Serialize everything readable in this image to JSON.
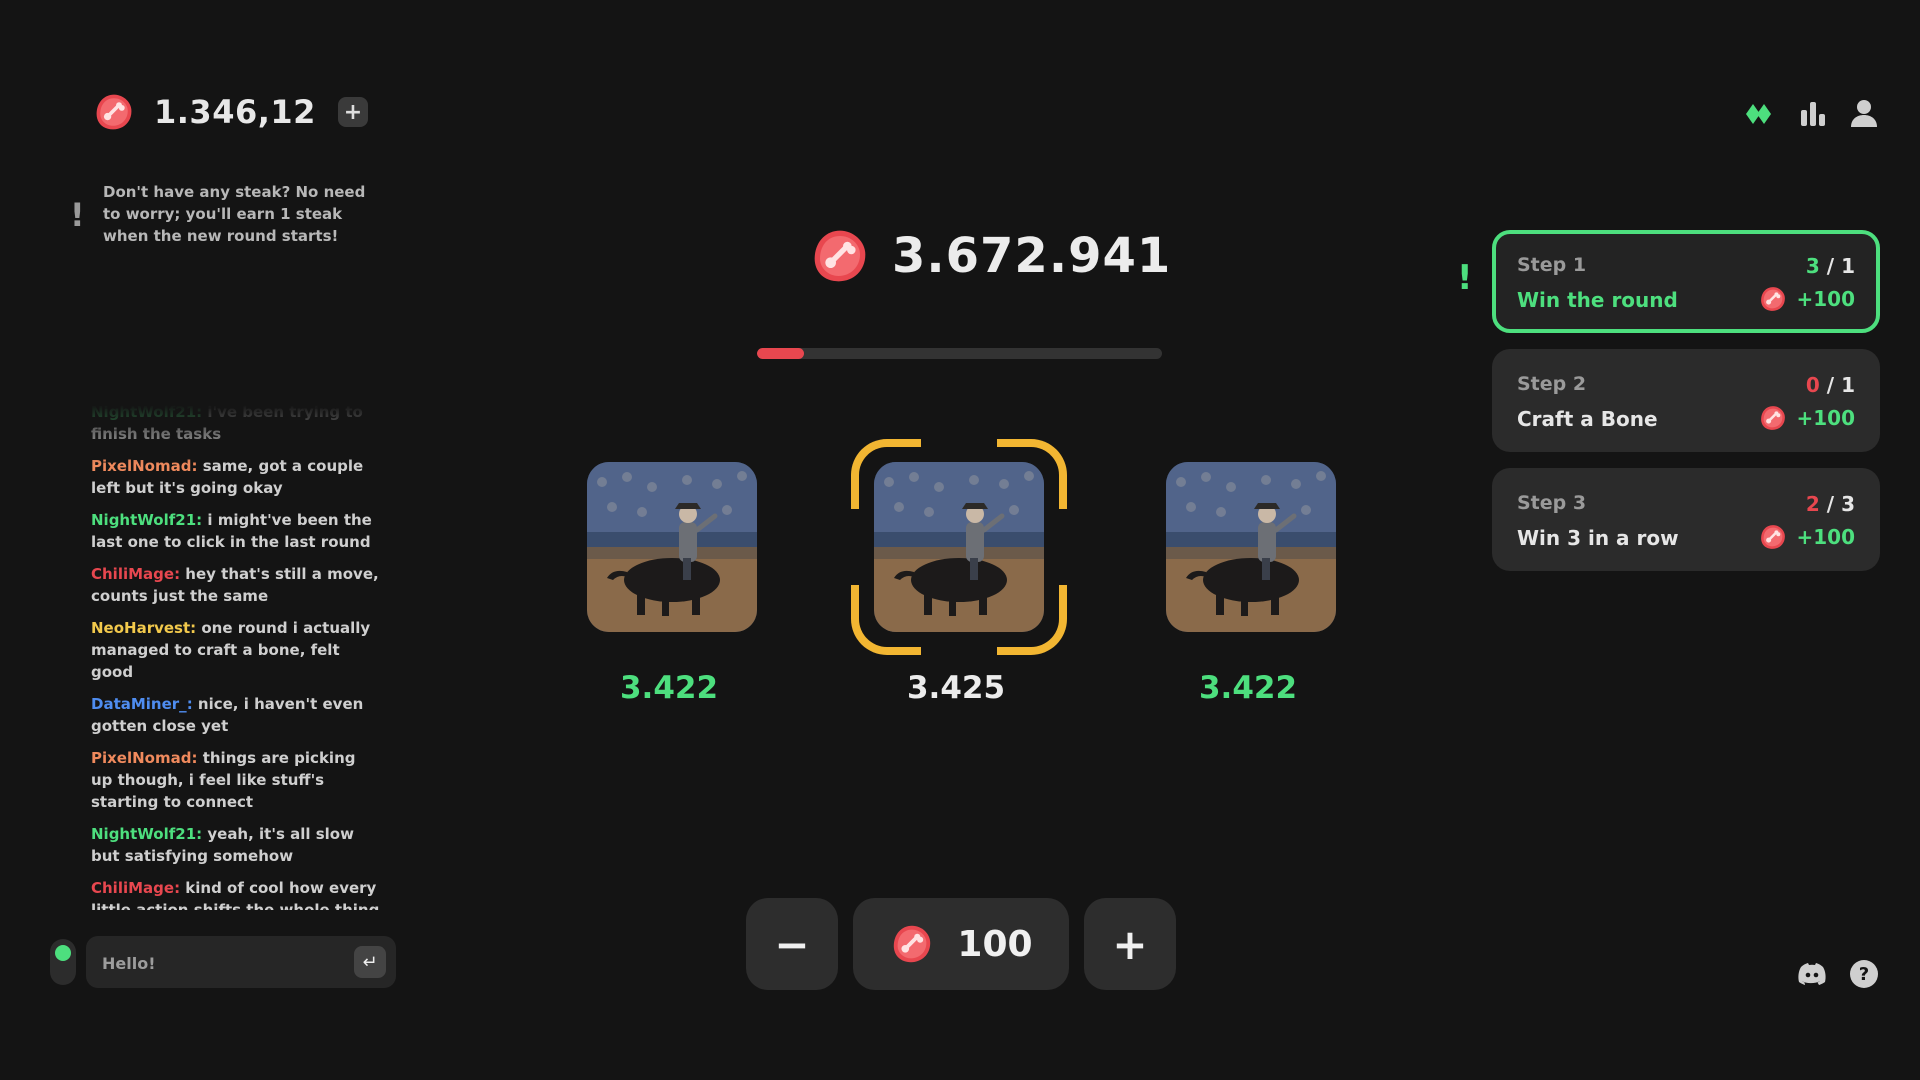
{
  "wallet": {
    "balance": "1.346,12",
    "add_label": "+",
    "icon": "steak-icon"
  },
  "info": {
    "text": "Don't have any steak? No need to worry; you'll earn 1 steak when the new round starts!",
    "mark": "!"
  },
  "chat": {
    "messages": [
      {
        "user": "NightWolf21",
        "sep": ":",
        "text": " i've been trying to finish the tasks",
        "color": "#4ddf7e"
      },
      {
        "user": "PixelNomad",
        "sep": ":",
        "text": " same, got a couple left but it's going okay",
        "color": "#f08a5d"
      },
      {
        "user": "NightWolf21",
        "sep": ":",
        "text": " i might've been the last one to click in the last round",
        "color": "#4ddf7e"
      },
      {
        "user": "ChiliMage",
        "sep": ":",
        "text": " hey that's still a move, counts just the same",
        "color": "#e8474f"
      },
      {
        "user": "NeoHarvest",
        "sep": ":",
        "text": " one round i actually managed to craft a bone, felt good",
        "color": "#f2c94c"
      },
      {
        "user": "DataMiner_",
        "sep": ":",
        "text": " nice, i haven't even gotten close yet",
        "color": "#4f8df0"
      },
      {
        "user": "PixelNomad",
        "sep": ":",
        "text": " things are picking up though, i feel like stuff's starting to connect",
        "color": "#f08a5d"
      },
      {
        "user": "NightWolf21",
        "sep": ":",
        "text": " yeah, it's all slow but satisfying somehow",
        "color": "#4ddf7e"
      },
      {
        "user": "ChiliMage",
        "sep": ":",
        "text": " kind of cool how every little action shifts the whole thing",
        "color": "#e8474f"
      }
    ],
    "input_placeholder": "Hello!",
    "send_icon": "enter-icon",
    "status_color": "#4ddf7e"
  },
  "round": {
    "pot": "3.672.941",
    "progress": 0.115
  },
  "choices": [
    {
      "value": "3.422",
      "selected": false,
      "color": "#4ddf7e"
    },
    {
      "value": "3.425",
      "selected": true,
      "color": "#ececec"
    },
    {
      "value": "3.422",
      "selected": false,
      "color": "#4ddf7e"
    }
  ],
  "bet": {
    "minus_label": "−",
    "plus_label": "+",
    "amount": "100"
  },
  "nav_icons": [
    "diamond-icon",
    "leaderboard-icon",
    "profile-icon"
  ],
  "steps": [
    {
      "title": "Step 1",
      "desc": "Win the round",
      "progress_done": "3",
      "progress_total": "1",
      "done_color": "#4ddf7e",
      "reward": "+100",
      "active": true
    },
    {
      "title": "Step 2",
      "desc": "Craft a Bone",
      "progress_done": "0",
      "progress_total": "1",
      "done_color": "#e8474f",
      "reward": "+100",
      "active": false
    },
    {
      "title": "Step 3",
      "desc": "Win 3 in a row",
      "progress_done": "2",
      "progress_total": "3",
      "done_color": "#e8474f",
      "reward": "+100",
      "active": false
    }
  ],
  "steps_alert": "!",
  "footer_icons": [
    "discord-icon",
    "help-icon"
  ],
  "help_glyph": "?",
  "colors": {
    "accent_green": "#4ddf7e",
    "accent_red": "#e8474f",
    "selector_yellow": "#f2b632"
  }
}
